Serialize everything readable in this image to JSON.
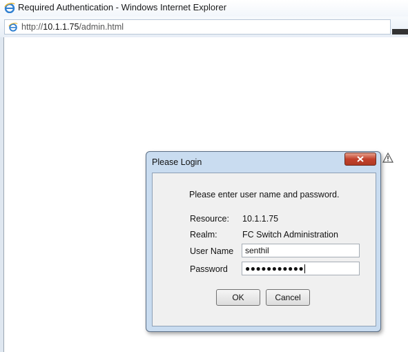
{
  "window": {
    "title": "Required Authentication - Windows Internet Explorer"
  },
  "address_bar": {
    "prefix": "http://",
    "host": "10.1.1.75",
    "path": "/admin.html"
  },
  "dialog": {
    "title": "Please Login",
    "prompt": "Please enter user name and password.",
    "resource_label": "Resource:",
    "resource_value": "10.1.1.75",
    "realm_label": "Realm:",
    "realm_value": "FC Switch Administration",
    "username_label": "User Name",
    "username_value": "senthil",
    "password_label": "Password",
    "password_value": "●●●●●●●●●●●",
    "ok_label": "OK",
    "cancel_label": "Cancel"
  },
  "icons": [
    "ie-logo-icon",
    "ie-page-icon",
    "close-icon",
    "warning-icon"
  ]
}
